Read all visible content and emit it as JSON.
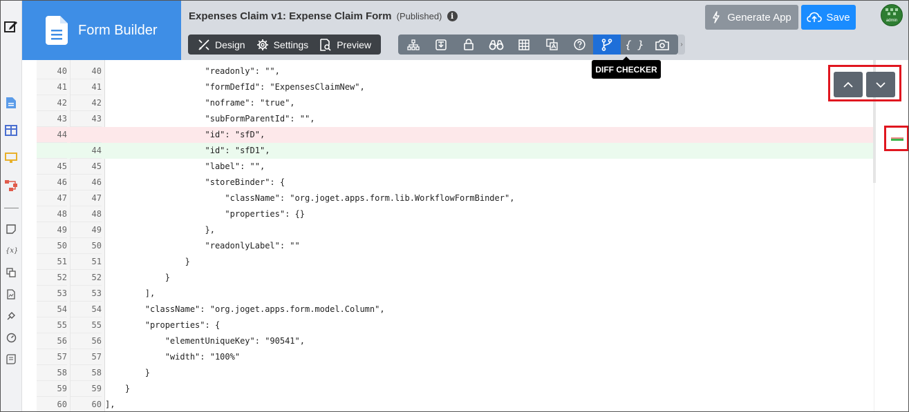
{
  "brand": {
    "title": "Form Builder"
  },
  "form": {
    "title": "Expenses Claim v1: Expense Claim Form",
    "status": "(Published)",
    "info_glyph": "i"
  },
  "modes": [
    {
      "label": "Design",
      "icon": "design-icon"
    },
    {
      "label": "Settings",
      "icon": "gear-icon"
    },
    {
      "label": "Preview",
      "icon": "preview-icon"
    }
  ],
  "tools": [
    "tree-icon",
    "import-icon",
    "lock-icon",
    "binoculars-icon",
    "table-icon",
    "translate-icon",
    "help-icon",
    "diff-checker-icon",
    "json-icon",
    "screenshot-icon"
  ],
  "tool_json_glyph": "{ }",
  "tool_scroll_glyph": "›",
  "buttons": {
    "generate_app": "Generate App",
    "save": "Save"
  },
  "user": {
    "avatar_label": "admin"
  },
  "tooltip": "DIFF CHECKER",
  "colors": {
    "brand": "#3e8ee6",
    "save": "#1a8cff",
    "active_tool": "#1e6fd9",
    "highlight": "#e0161f",
    "deleted": "#fde8ea",
    "added": "#ebfaee"
  },
  "diff_lines": [
    {
      "left": "40",
      "right": "40",
      "code": "                    \"readonly\": \"\",",
      "type": "same"
    },
    {
      "left": "41",
      "right": "41",
      "code": "                    \"formDefId\": \"ExpensesClaimNew\",",
      "type": "same"
    },
    {
      "left": "42",
      "right": "42",
      "code": "                    \"noframe\": \"true\",",
      "type": "same"
    },
    {
      "left": "43",
      "right": "43",
      "code": "                    \"subFormParentId\": \"\",",
      "type": "same"
    },
    {
      "left": "44",
      "right": "",
      "code": "                    \"id\": \"sfD\",",
      "type": "del"
    },
    {
      "left": "",
      "right": "44",
      "code": "                    \"id\": \"sfD1\",",
      "type": "add"
    },
    {
      "left": "45",
      "right": "45",
      "code": "                    \"label\": \"\",",
      "type": "same"
    },
    {
      "left": "46",
      "right": "46",
      "code": "                    \"storeBinder\": {",
      "type": "same"
    },
    {
      "left": "47",
      "right": "47",
      "code": "                        \"className\": \"org.joget.apps.form.lib.WorkflowFormBinder\",",
      "type": "same"
    },
    {
      "left": "48",
      "right": "48",
      "code": "                        \"properties\": {}",
      "type": "same"
    },
    {
      "left": "49",
      "right": "49",
      "code": "                    },",
      "type": "same"
    },
    {
      "left": "50",
      "right": "50",
      "code": "                    \"readonlyLabel\": \"\"",
      "type": "same"
    },
    {
      "left": "51",
      "right": "51",
      "code": "                }",
      "type": "same"
    },
    {
      "left": "52",
      "right": "52",
      "code": "            }",
      "type": "same"
    },
    {
      "left": "53",
      "right": "53",
      "code": "        ],",
      "type": "same"
    },
    {
      "left": "54",
      "right": "54",
      "code": "        \"className\": \"org.joget.apps.form.model.Column\",",
      "type": "same"
    },
    {
      "left": "55",
      "right": "55",
      "code": "        \"properties\": {",
      "type": "same"
    },
    {
      "left": "56",
      "right": "56",
      "code": "            \"elementUniqueKey\": \"90541\",",
      "type": "same"
    },
    {
      "left": "57",
      "right": "57",
      "code": "            \"width\": \"100%\"",
      "type": "same"
    },
    {
      "left": "58",
      "right": "58",
      "code": "        }",
      "type": "same"
    },
    {
      "left": "59",
      "right": "59",
      "code": "    }",
      "type": "same"
    },
    {
      "left": "60",
      "right": "60",
      "code": "],",
      "type": "same"
    }
  ]
}
